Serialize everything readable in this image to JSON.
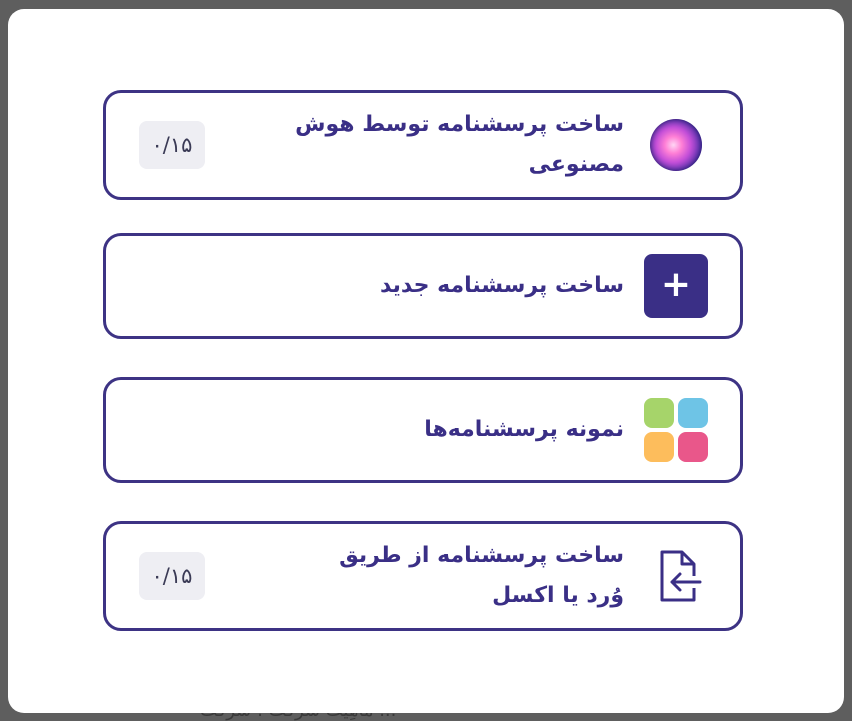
{
  "background": {
    "partial_text": "ماهِیت شرکت : شرکت ..."
  },
  "options": [
    {
      "label": "ساخت پرسشنامه توسط هوش مصنوعی",
      "quota": "۰/۱۵",
      "icon": "ai-orb-icon"
    },
    {
      "label": "ساخت پرسشنامه جدید",
      "icon": "plus-icon"
    },
    {
      "label": "نمونه پرسشنامه‌ها",
      "icon": "templates-grid-icon"
    },
    {
      "label": "ساخت پرسشنامه از طریق وُرد یا اکسل",
      "quota": "۰/۱۵",
      "icon": "file-import-icon"
    }
  ],
  "colors": {
    "accent": "#3a2f86",
    "border": "#3d3384",
    "grid": [
      "#a6d46a",
      "#6ec4e6",
      "#fdbd5c",
      "#e9578a"
    ]
  }
}
